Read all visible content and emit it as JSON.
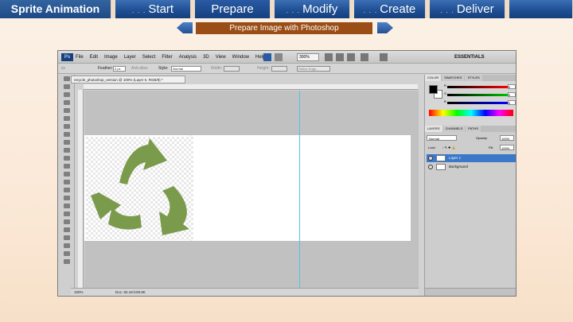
{
  "nav": {
    "title": "Sprite Animation",
    "tabs": [
      {
        "dots": ". . .",
        "label": "Start"
      },
      {
        "dots": "",
        "label": "Prepare"
      },
      {
        "dots": ". . .",
        "label": "Modify"
      },
      {
        "dots": ". . .",
        "label": "Create"
      },
      {
        "dots": ". . .",
        "label": "Deliver"
      }
    ]
  },
  "substep": {
    "label": "Prepare Image with Photoshop"
  },
  "photoshop": {
    "logo": "Ps",
    "menu": [
      "File",
      "Edit",
      "Image",
      "Layer",
      "Select",
      "Filter",
      "Analysis",
      "3D",
      "View",
      "Window",
      "Help"
    ],
    "zoom": "300%",
    "workspace": "ESSENTIALS",
    "options": {
      "feather_label": "Feather:",
      "feather_value": "0 px",
      "antialias": "Anti-alias",
      "style_label": "Style:",
      "style_value": "Normal",
      "width_label": "Width:",
      "height_label": "Height:",
      "refine_edge": "Refine Edge..."
    },
    "document_tab": "recycle_photoshop_version @ 100% (Layer 0, RGB/8) *",
    "status": {
      "zoom": "100%",
      "doc": "Doc: 82.1K/109.9K"
    },
    "color_panel": {
      "tabs": [
        "COLOR",
        "SWATCHES",
        "STYLES"
      ],
      "r": "R",
      "g": "G",
      "b": "B",
      "r_value": "0",
      "g_value": "0",
      "b_value": "0"
    },
    "layers_panel": {
      "tabs": [
        "LAYERS",
        "CHANNELS",
        "PATHS"
      ],
      "blend_mode": "Normal",
      "opacity_label": "Opacity:",
      "opacity_value": "100%",
      "lock_label": "Lock:",
      "fill_label": "Fill:",
      "fill_value": "100%",
      "layers": [
        {
          "name": "Layer 1",
          "active": true
        },
        {
          "name": "Background",
          "active": false
        }
      ]
    },
    "colors": {
      "recycle_green": "#7a9a4c",
      "guide": "#4cc6e6",
      "nav_blue": "#1f4f94",
      "substep_brown": "#9a4d15"
    }
  }
}
